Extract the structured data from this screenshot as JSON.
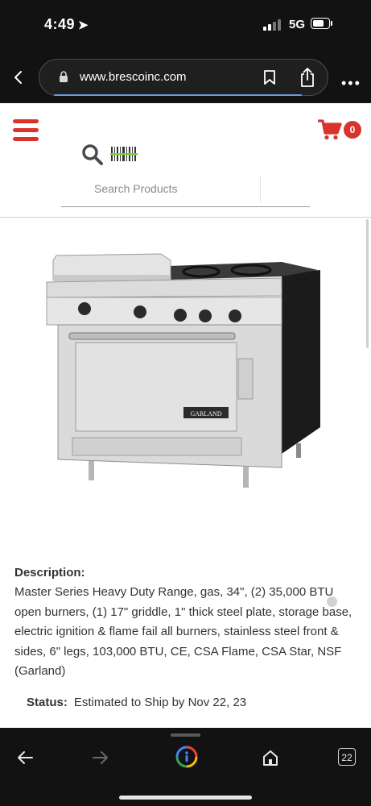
{
  "status_bar": {
    "time": "4:49",
    "network": "5G"
  },
  "browser": {
    "url": "www.brescoinc.com",
    "tab_count": "22"
  },
  "site_header": {
    "cart_count": "0",
    "search_placeholder": "Search Products",
    "accent_color": "#d9342b"
  },
  "product": {
    "description_label": "Description:",
    "description_text": "Master Series Heavy Duty Range, gas, 34\", (2) 35,000 BTU open burners, (1) 17\" griddle, 1\" thick steel plate, storage base, electric ignition & flame fail all burners, stainless steel front & sides, 6\" legs, 103,000 BTU, CE, CSA Flame, CSA Star, NSF (Garland)",
    "status_label": "Status:",
    "status_value": "Estimated to Ship by Nov 22, 23",
    "brand_plate": "GARLAND"
  },
  "icons": {
    "location": "location-arrow-icon",
    "lock": "lock-icon",
    "bookmark": "bookmark-icon",
    "share": "share-icon",
    "menu": "hamburger-icon",
    "cart": "cart-icon",
    "search": "search-icon",
    "barcode": "barcode-icon",
    "lens": "google-lens-icon",
    "home": "home-icon"
  }
}
